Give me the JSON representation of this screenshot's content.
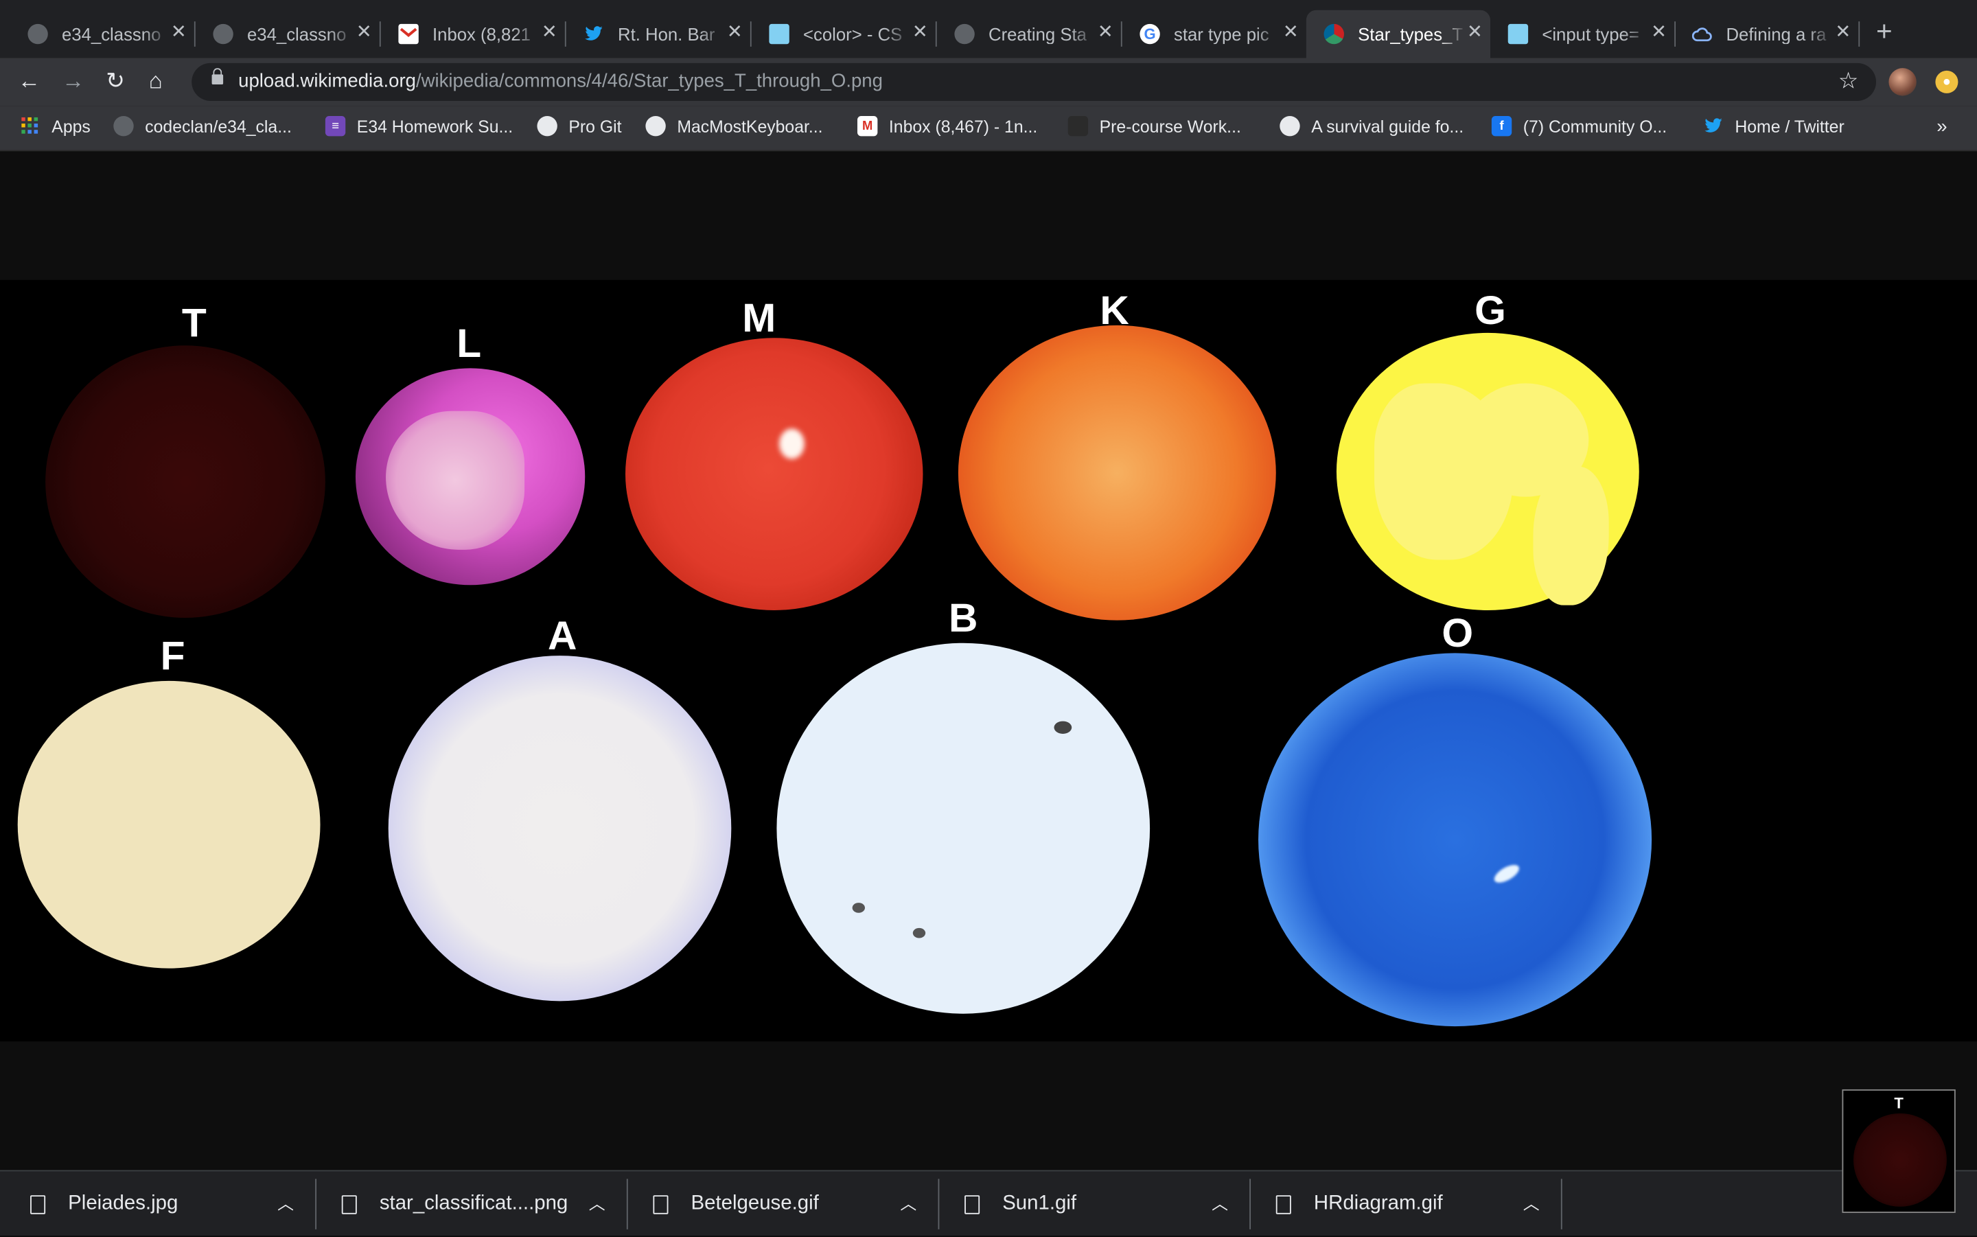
{
  "tabs": [
    {
      "title": "e34_classno",
      "icon": "github-icon"
    },
    {
      "title": "e34_classno",
      "icon": "github-icon"
    },
    {
      "title": "Inbox (8,821",
      "icon": "gmail-icon"
    },
    {
      "title": "Rt. Hon. Bar",
      "icon": "twitter-icon"
    },
    {
      "title": "<color> - CS",
      "icon": "mdn-icon"
    },
    {
      "title": "Creating Sta",
      "icon": "globe-icon"
    },
    {
      "title": "star type pic",
      "icon": "google-icon"
    },
    {
      "title": "Star_types_T",
      "icon": "wikimedia-icon",
      "active": true
    },
    {
      "title": "<input type=",
      "icon": "mdn-icon"
    },
    {
      "title": "Defining a ra",
      "icon": "cloud-icon"
    }
  ],
  "address": {
    "host": "upload.wikimedia.org",
    "path": "/wikipedia/commons/4/46/Star_types_T_through_O.png"
  },
  "bookmarks": [
    {
      "label": "Apps",
      "icon": "apps-grid-icon"
    },
    {
      "label": "codeclan/e34_cla...",
      "icon": "github-icon"
    },
    {
      "label": "E34 Homework Su...",
      "icon": "form-icon"
    },
    {
      "label": "Pro Git",
      "icon": "globe-icon"
    },
    {
      "label": "MacMostKeyboar...",
      "icon": "globe-icon"
    },
    {
      "label": "Inbox (8,467) - 1n...",
      "icon": "gmail-icon"
    },
    {
      "label": "Pre-course Work...",
      "icon": "blank-icon"
    },
    {
      "label": "A survival guide fo...",
      "icon": "globe-icon"
    },
    {
      "label": "(7) Community O...",
      "icon": "facebook-icon"
    },
    {
      "label": "Home / Twitter",
      "icon": "twitter-icon"
    }
  ],
  "stars": [
    {
      "letter": "T",
      "color": "#3a0808"
    },
    {
      "letter": "L",
      "color": "#d44fc4"
    },
    {
      "letter": "M",
      "color": "#e03a2a"
    },
    {
      "letter": "K",
      "color": "#f07a2a"
    },
    {
      "letter": "G",
      "color": "#fcf545"
    },
    {
      "letter": "F",
      "color": "#f0e4bc"
    },
    {
      "letter": "A",
      "color": "#f0eeee"
    },
    {
      "letter": "B",
      "color": "#e6f0fa"
    },
    {
      "letter": "O",
      "color": "#2a70e0"
    }
  ],
  "downloads": [
    {
      "name": "Pleiades.jpg"
    },
    {
      "name": "star_classificat....png"
    },
    {
      "name": "Betelgeuse.gif"
    },
    {
      "name": "Sun1.gif"
    },
    {
      "name": "HRdiagram.gif"
    }
  ],
  "thumbnail": {
    "letter": "T"
  }
}
